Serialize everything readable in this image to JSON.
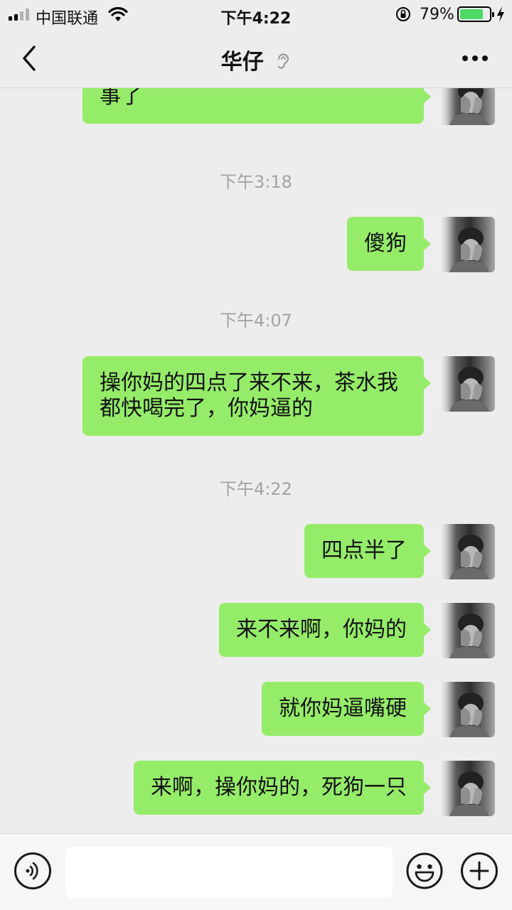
{
  "status_bar": {
    "carrier": "中国联通",
    "time": "下午4:22",
    "battery_percent": "79%",
    "battery_level": 0.79,
    "icons": [
      "signal-icon",
      "wifi-icon",
      "orientation-lock-icon",
      "battery-icon",
      "charging-bolt-icon"
    ]
  },
  "nav": {
    "title": "华仔",
    "icons": [
      "back-chevron-icon",
      "earpiece-icon",
      "more-icon"
    ]
  },
  "chat": {
    "messages": [
      {
        "type": "sent",
        "text": "事了"
      },
      {
        "type": "time",
        "text": "下午3:18"
      },
      {
        "type": "sent",
        "text": "傻狗"
      },
      {
        "type": "time",
        "text": "下午4:07"
      },
      {
        "type": "sent",
        "text": "操你妈的四点了来不来，茶水我都快喝完了，你妈逼的"
      },
      {
        "type": "time",
        "text": "下午4:22"
      },
      {
        "type": "sent",
        "text": "四点半了"
      },
      {
        "type": "sent",
        "text": "来不来啊，你妈的"
      },
      {
        "type": "sent",
        "text": "就你妈逼嘴硬"
      },
      {
        "type": "sent",
        "text": "来啊，操你妈的，死狗一只"
      }
    ]
  },
  "input_bar": {
    "icons": [
      "voice-icon",
      "emoji-icon",
      "plus-icon"
    ],
    "placeholder": ""
  },
  "colors": {
    "sent_bubble": "#95ec69",
    "background": "#ededed",
    "timestamp": "#a3a3a3",
    "battery_fill": "#4cd964"
  }
}
